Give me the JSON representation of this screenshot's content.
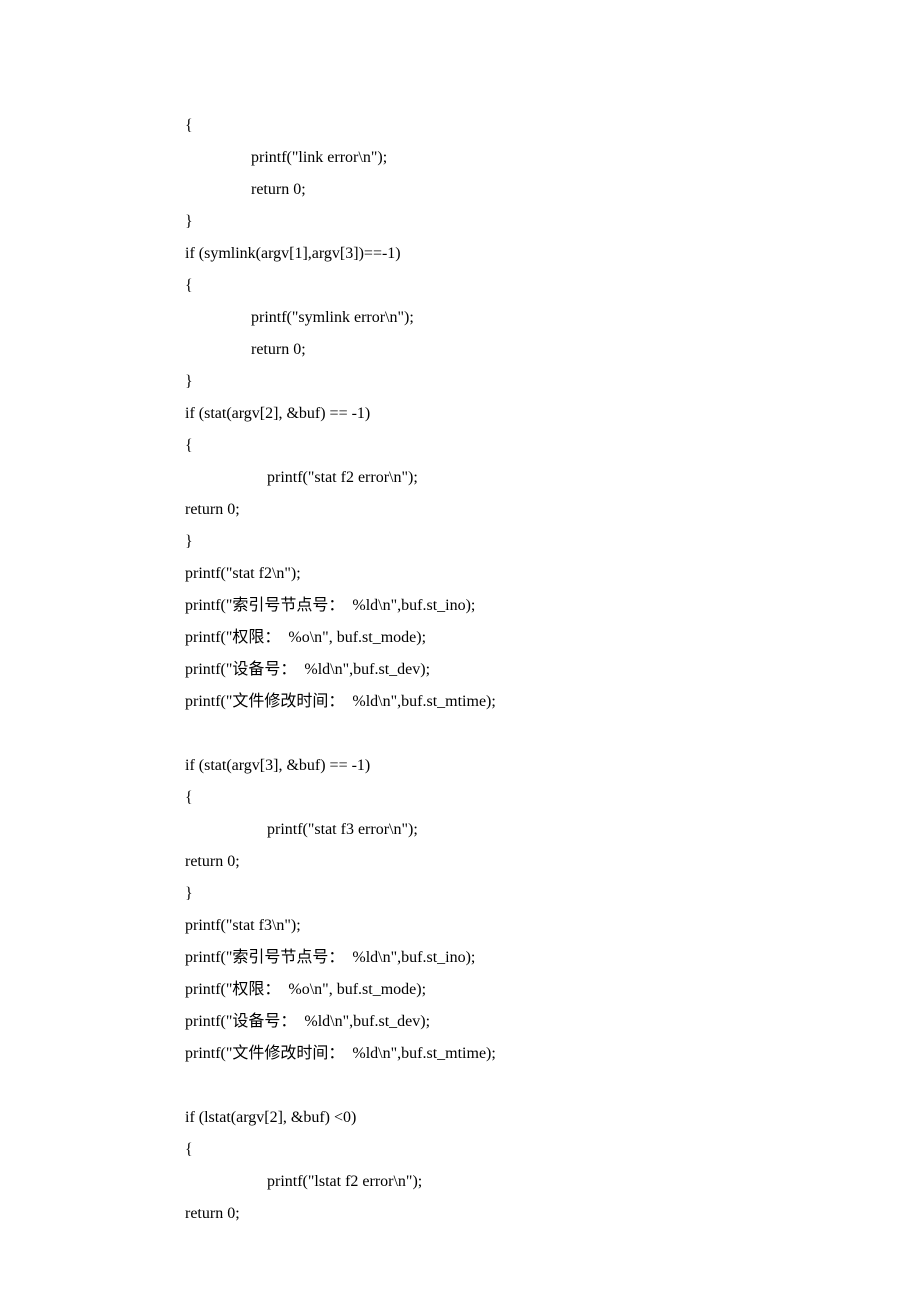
{
  "code": {
    "l01": "{",
    "l02": "printf(\"link error\\n\");",
    "l03": "return 0;",
    "l04": "}",
    "l05": "if (symlink(argv[1],argv[3])==-1)",
    "l06": "{",
    "l07": "printf(\"symlink error\\n\");",
    "l08": "return 0;",
    "l09": "}",
    "l10": "if (stat(argv[2], &buf) == -1)",
    "l11": "{",
    "l12": "printf(\"stat f2 error\\n\");",
    "l13": "return 0;",
    "l14": "}",
    "l15": "printf(\"stat f2\\n\");",
    "l16": "printf(\"索引号节点号：  %ld\\n\",buf.st_ino);",
    "l17": "printf(\"权限：  %o\\n\", buf.st_mode);",
    "l18": "printf(\"设备号：  %ld\\n\",buf.st_dev);",
    "l19": "printf(\"文件修改时间：  %ld\\n\",buf.st_mtime);",
    "l20": "if (stat(argv[3], &buf) == -1)",
    "l21": "{",
    "l22": "printf(\"stat f3 error\\n\");",
    "l23": "return 0;",
    "l24": "}",
    "l25": "printf(\"stat f3\\n\");",
    "l26": "printf(\"索引号节点号：  %ld\\n\",buf.st_ino);",
    "l27": "printf(\"权限：  %o\\n\", buf.st_mode);",
    "l28": "printf(\"设备号：  %ld\\n\",buf.st_dev);",
    "l29": "printf(\"文件修改时间：  %ld\\n\",buf.st_mtime);",
    "l30": "if (lstat(argv[2], &buf) <0)",
    "l31": "{",
    "l32": "printf(\"lstat f2 error\\n\");",
    "l33": "return 0;"
  }
}
